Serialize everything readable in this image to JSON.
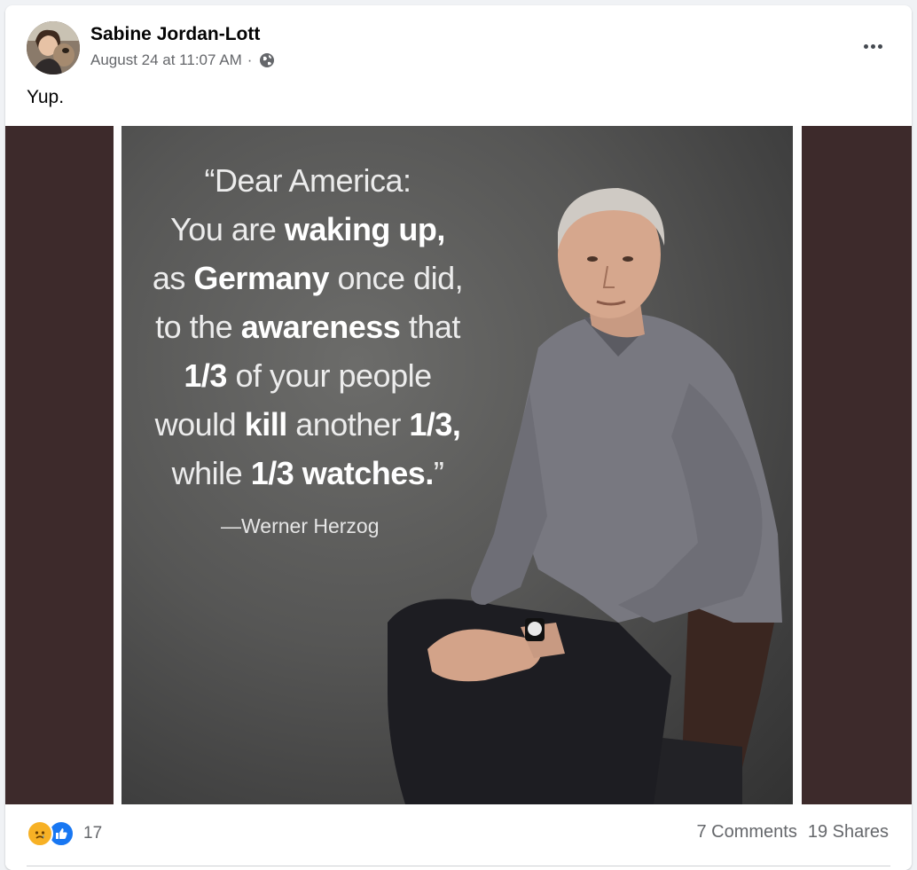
{
  "post": {
    "author": "Sabine Jordan-Lott",
    "timestamp": "August 24 at 11:07 AM",
    "separator": "·",
    "privacy_icon": "globe-icon",
    "caption": "Yup.",
    "more_icon": "more-options-icon"
  },
  "image": {
    "quote_lines": [
      [
        {
          "t": "“Dear America:",
          "b": false
        }
      ],
      [
        {
          "t": "You are ",
          "b": false
        },
        {
          "t": "waking up,",
          "b": true
        }
      ],
      [
        {
          "t": "as ",
          "b": false
        },
        {
          "t": "Germany",
          "b": true
        },
        {
          "t": " once did,",
          "b": false
        }
      ],
      [
        {
          "t": "to the ",
          "b": false
        },
        {
          "t": "awareness",
          "b": true
        },
        {
          "t": " that",
          "b": false
        }
      ],
      [
        {
          "t": "1/3",
          "b": true
        },
        {
          "t": " of your people",
          "b": false
        }
      ],
      [
        {
          "t": "would ",
          "b": false
        },
        {
          "t": "kill",
          "b": true
        },
        {
          "t": " another ",
          "b": false
        },
        {
          "t": "1/3,",
          "b": true
        }
      ],
      [
        {
          "t": "while ",
          "b": false
        },
        {
          "t": "1/3 watches.",
          "b": true
        },
        {
          "t": "”",
          "b": false
        }
      ]
    ],
    "attribution": "—Werner Herzog"
  },
  "footer": {
    "reaction_icons": [
      "sad-reaction-icon",
      "like-reaction-icon"
    ],
    "reaction_count": "17",
    "comments": "7 Comments",
    "shares": "19 Shares"
  },
  "colors": {
    "media_background": "#3d2a2b",
    "like_blue": "#1877f2",
    "secondary_text": "#65676b"
  }
}
